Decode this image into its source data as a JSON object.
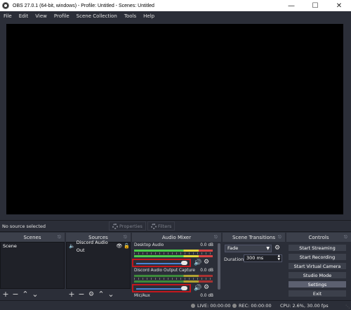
{
  "window": {
    "title": "OBS 27.0.1 (64-bit, windows) - Profile: Untitled - Scenes: Untitled"
  },
  "menu": [
    "File",
    "Edit",
    "View",
    "Profile",
    "Scene Collection",
    "Tools",
    "Help"
  ],
  "context": {
    "no_source": "No source selected",
    "properties": "Properties",
    "filters": "Filters"
  },
  "scenes": {
    "header": "Scenes",
    "items": [
      "Scene"
    ]
  },
  "sources": {
    "header": "Sources",
    "items": [
      {
        "name": "Discord Audio Out"
      }
    ]
  },
  "mixer": {
    "header": "Audio Mixer",
    "channels": [
      {
        "name": "Desktop Audio",
        "db": "0.0 dB",
        "volume": 1.0
      },
      {
        "name": "Discord Audio Output Capture",
        "db": "0.0 dB",
        "volume": 1.0
      },
      {
        "name": "Mic/Aux",
        "db": "0.0 dB"
      }
    ]
  },
  "transitions": {
    "header": "Scene Transitions",
    "selected": "Fade",
    "duration_label": "Duration",
    "duration_value": "300 ms"
  },
  "controls": {
    "header": "Controls",
    "buttons": [
      "Start Streaming",
      "Start Recording",
      "Start Virtual Camera",
      "Studio Mode",
      "Settings",
      "Exit"
    ]
  },
  "status": {
    "live": "LIVE: 00:00:00",
    "rec": "REC: 00:00:00",
    "cpu": "CPU: 2.6%, 30.00 fps"
  },
  "colors": {
    "highlight_box": "#c2171d",
    "slider": "#4a84d8",
    "bg": "#2b2e38",
    "panel": "#1f2128"
  }
}
